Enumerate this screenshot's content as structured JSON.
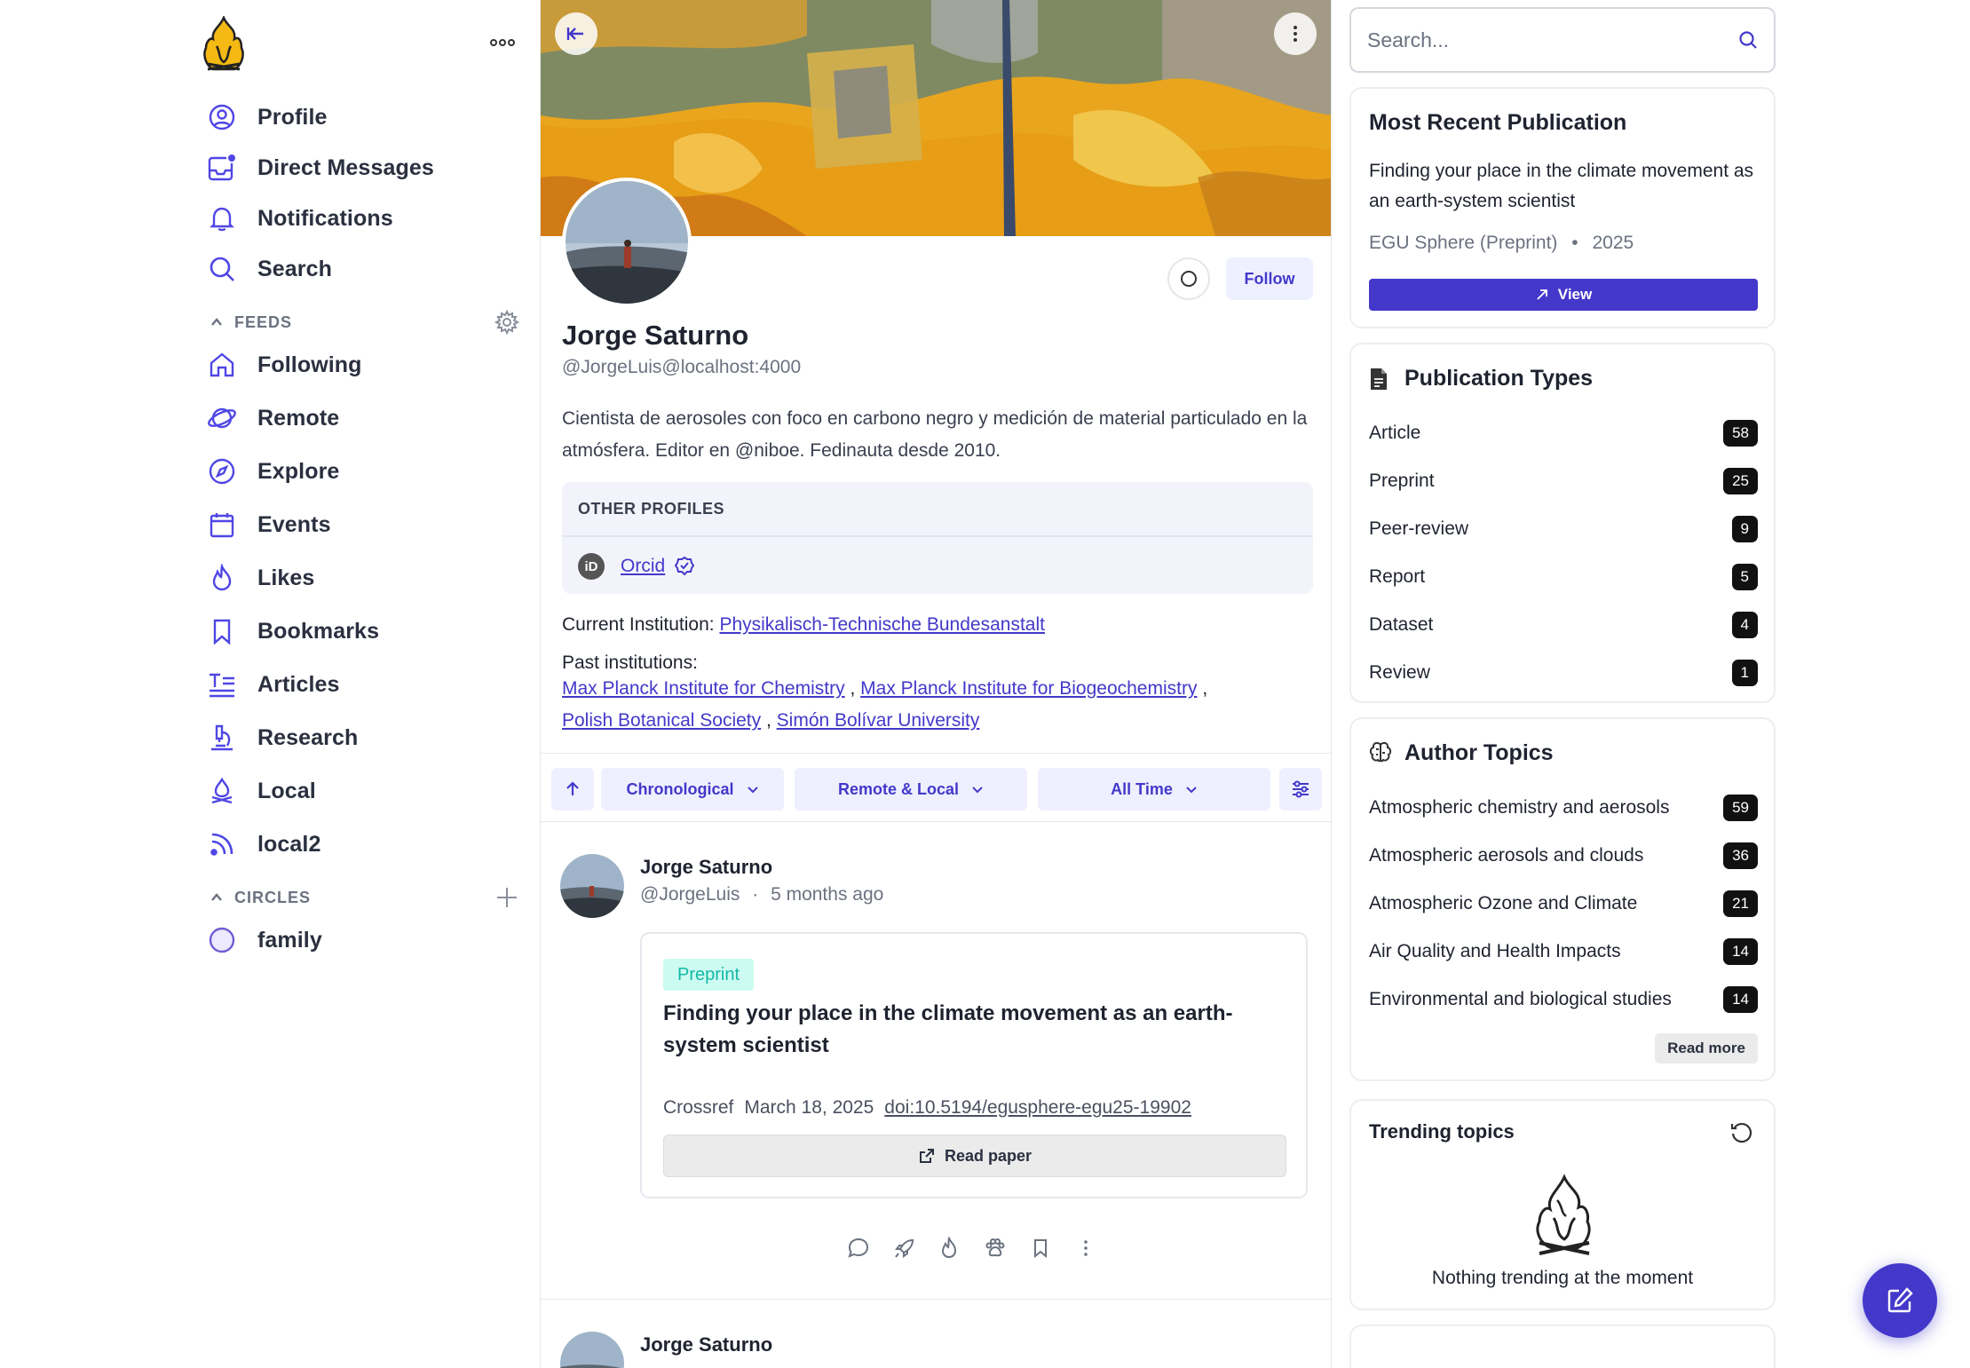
{
  "sidebar": {
    "nav": [
      {
        "label": "Profile",
        "icon": "user-circle-icon"
      },
      {
        "label": "Direct Messages",
        "icon": "inbox-icon"
      },
      {
        "label": "Notifications",
        "icon": "bell-icon"
      },
      {
        "label": "Search",
        "icon": "search-icon"
      }
    ],
    "feeds_title": "FEEDS",
    "feeds": [
      {
        "label": "Following",
        "icon": "home-icon"
      },
      {
        "label": "Remote",
        "icon": "planet-icon"
      },
      {
        "label": "Explore",
        "icon": "compass-icon"
      },
      {
        "label": "Events",
        "icon": "calendar-icon"
      },
      {
        "label": "Likes",
        "icon": "flame-icon"
      },
      {
        "label": "Bookmarks",
        "icon": "bookmark-icon"
      },
      {
        "label": "Articles",
        "icon": "text-lines-icon"
      },
      {
        "label": "Research",
        "icon": "microscope-icon"
      },
      {
        "label": "Local",
        "icon": "campfire-icon"
      },
      {
        "label": "local2",
        "icon": "rss-icon"
      }
    ],
    "circles_title": "CIRCLES",
    "circles": [
      {
        "label": "family",
        "icon": "circle-icon"
      }
    ]
  },
  "profile": {
    "name": "Jorge Saturno",
    "handle": "@JorgeLuis@localhost:4000",
    "bio": "Cientista de aerosoles con foco en carbono negro y medición de material particulado en la atmósfera. Editor en @niboe. Fedinauta desde 2010.",
    "follow_label": "Follow",
    "other_profiles_title": "OTHER PROFILES",
    "orcid_icon_text": "iD",
    "orcid_label": "Orcid",
    "current_institution_label": "Current Institution:",
    "current_institution": "Physikalisch-Technische Bundesanstalt",
    "past_institutions_label": "Past institutions:",
    "past_institutions": [
      "Max Planck Institute for Chemistry",
      "Max Planck Institute for Biogeochemistry",
      "Polish Botanical Society",
      "Simón Bolívar University"
    ],
    "separator": ","
  },
  "filters": {
    "order": "Chronological",
    "source": "Remote & Local",
    "time": "All Time"
  },
  "post": {
    "author": "Jorge Saturno",
    "handle": "@JorgeLuis",
    "dot": "·",
    "time": "5 months ago",
    "badge": "Preprint",
    "title": "Finding your place in the climate movement as an earth-system scientist",
    "source": "Crossref",
    "date": "March 18, 2025",
    "doi": "doi:10.5194/egusphere-egu25-19902",
    "read_label": "Read paper"
  },
  "post2": {
    "author": "Jorge Saturno"
  },
  "right": {
    "search_placeholder": "Search...",
    "recent": {
      "title": "Most Recent Publication",
      "pub_title": "Finding your place in the climate movement as an earth-system scientist",
      "venue": "EGU Sphere (Preprint)",
      "dot": "•",
      "year": "2025",
      "view_label": "View"
    },
    "types": {
      "title": "Publication Types",
      "items": [
        {
          "label": "Article",
          "count": "58"
        },
        {
          "label": "Preprint",
          "count": "25"
        },
        {
          "label": "Peer-review",
          "count": "9"
        },
        {
          "label": "Report",
          "count": "5"
        },
        {
          "label": "Dataset",
          "count": "4"
        },
        {
          "label": "Review",
          "count": "1"
        }
      ]
    },
    "topics": {
      "title": "Author Topics",
      "items": [
        {
          "label": "Atmospheric chemistry and aerosols",
          "count": "59"
        },
        {
          "label": "Atmospheric aerosols and clouds",
          "count": "36"
        },
        {
          "label": "Atmospheric Ozone and Climate",
          "count": "21"
        },
        {
          "label": "Air Quality and Health Impacts",
          "count": "14"
        },
        {
          "label": "Environmental and biological studies",
          "count": "14"
        }
      ],
      "read_more": "Read more"
    },
    "trending": {
      "title": "Trending topics",
      "empty": "Nothing trending at the moment"
    }
  },
  "colors": {
    "accent": "#4338ca",
    "accent_light": "#eef0ff",
    "preprint_bg": "#ccfbf1",
    "preprint_fg": "#14b8a6"
  }
}
